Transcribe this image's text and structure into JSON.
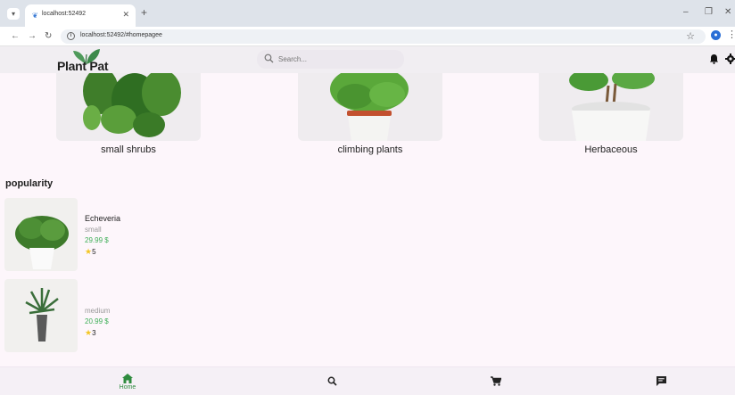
{
  "browser": {
    "tab_title": "localhost:52492",
    "url": "localhost:52492/#homepagee"
  },
  "header": {
    "logo_text": "Plant Pat",
    "search_placeholder": "Search...",
    "icons": [
      "bell-icon",
      "gear-icon"
    ]
  },
  "categories": [
    {
      "label": "small shrubs"
    },
    {
      "label": "climbing plants"
    },
    {
      "label": "Herbaceous"
    }
  ],
  "section_title": "popularity",
  "popular": [
    {
      "name": "Echeveria",
      "size": "small",
      "price": "29.99 $",
      "rating": "5"
    },
    {
      "name": "",
      "size": "medium",
      "price": "20.99 $",
      "rating": "3"
    }
  ],
  "bottom_nav": {
    "home_label": "Home",
    "items": [
      "home-icon",
      "search-icon",
      "cart-icon",
      "chat-icon"
    ]
  },
  "colors": {
    "accent_green": "#2e8b3e",
    "price_green": "#3cae55",
    "star_yellow": "#f3c623",
    "background": "#fdf6fb"
  }
}
